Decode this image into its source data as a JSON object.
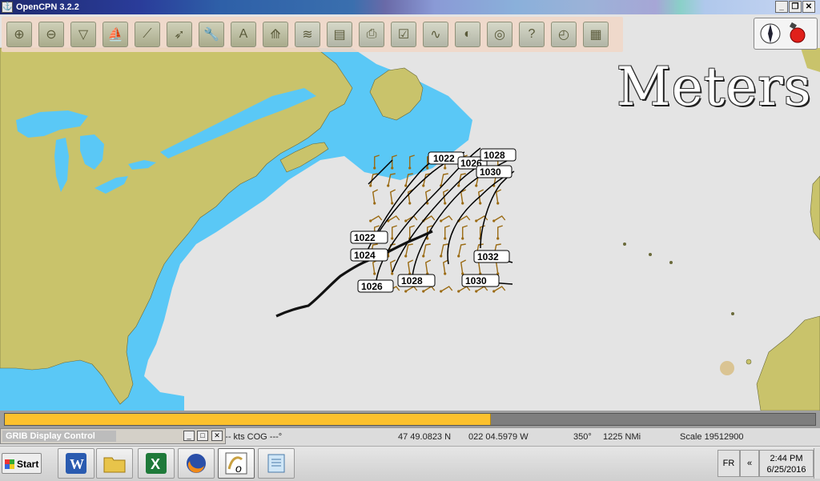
{
  "window": {
    "title": "OpenCPN 3.2.2",
    "minimize_label": "_",
    "restore_label": "❐",
    "close_label": "✕"
  },
  "toolbar": {
    "buttons": [
      {
        "name": "zoom-in",
        "icon": "magnifier-plus"
      },
      {
        "name": "zoom-out",
        "icon": "magnifier-minus"
      },
      {
        "name": "scale-in",
        "icon": "funnel"
      },
      {
        "name": "scale-out",
        "icon": "sailboat"
      },
      {
        "name": "create-route",
        "icon": "route"
      },
      {
        "name": "auto-follow",
        "icon": "ship"
      },
      {
        "name": "settings",
        "icon": "wrench"
      },
      {
        "name": "text",
        "icon": "letter-a"
      },
      {
        "name": "current-tide",
        "icon": "tide"
      },
      {
        "name": "chart-quilting",
        "icon": "layers"
      },
      {
        "name": "print",
        "icon": "printer"
      },
      {
        "name": "route-manager",
        "icon": "checklist"
      },
      {
        "name": "track",
        "icon": "track"
      },
      {
        "name": "color-scheme",
        "icon": "palette"
      },
      {
        "name": "mob",
        "icon": "lifebuoy"
      },
      {
        "name": "help",
        "icon": "question"
      },
      {
        "name": "dashboard",
        "icon": "gauges"
      },
      {
        "name": "grib",
        "icon": "grib-map"
      }
    ]
  },
  "overlay": {
    "units_label": "Meters"
  },
  "isobars": {
    "labels": [
      "1022",
      "1026",
      "1028",
      "1030",
      "1022",
      "1024",
      "1032",
      "1026",
      "1028",
      "1030"
    ]
  },
  "progress": {
    "fraction": 0.6
  },
  "status": {
    "sog": "SOG --- kts  COG ---°",
    "lat": "47 49.0823 N",
    "lon": "022 04.5979 W",
    "bearing": "350°",
    "distance": "1225 NMi",
    "scale": "Scale 19512900"
  },
  "grib": {
    "title": "GRIB Display Control",
    "min_label": "_",
    "max_label": "□",
    "close_label": "✕"
  },
  "taskbar": {
    "start_label": "Start",
    "apps": [
      "word",
      "explorer",
      "excel",
      "firefox",
      "opencpn",
      "notepad"
    ],
    "language": "FR",
    "tray_chevron": "«",
    "time": "2:44 PM",
    "date": "6/25/2016"
  },
  "colors": {
    "land": "#c9c36b",
    "water_shallow": "#5ac8f6",
    "sea": "#e4e4e4",
    "progress": "#fcc12d",
    "barb": "#9a6a12"
  }
}
